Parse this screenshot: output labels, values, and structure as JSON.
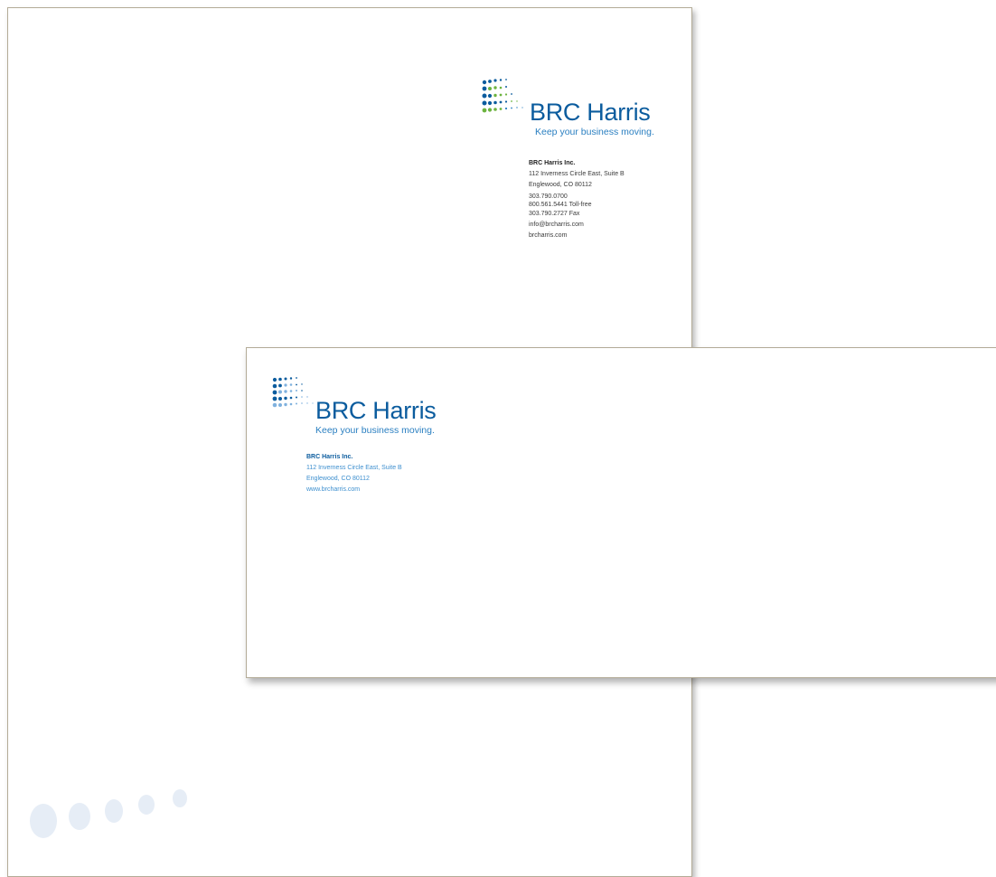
{
  "colors": {
    "brand_blue": "#0b5c9e",
    "light_blue": "#2a7fc1",
    "green": "#6cb33f",
    "paper_border": "#b3ab97",
    "watermark": "#e6edf6"
  },
  "letterhead": {
    "logo": {
      "brand": "BRC Harris",
      "tagline": "Keep your business moving.",
      "icon": "dot-grid-logo-icon"
    },
    "contact": {
      "company": "BRC Harris Inc.",
      "address1": "112 Inverness Circle East, Suite B",
      "address2": "Englewood, CO 80112",
      "phone": "303.790.0700",
      "tollfree": "800.561.5441 Toll-free",
      "fax": "303.790.2727 Fax",
      "email": "info@brcharris.com",
      "web": "brcharris.com"
    },
    "watermark_icon": "dot-row-watermark-icon"
  },
  "envelope": {
    "logo": {
      "brand": "BRC Harris",
      "tagline": "Keep your business moving.",
      "icon": "dot-grid-logo-icon"
    },
    "contact": {
      "company": "BRC Harris Inc.",
      "address1": "112 Inverness Circle East, Suite B",
      "address2": "Englewood, CO 80112",
      "web": "www.brcharris.com"
    }
  }
}
